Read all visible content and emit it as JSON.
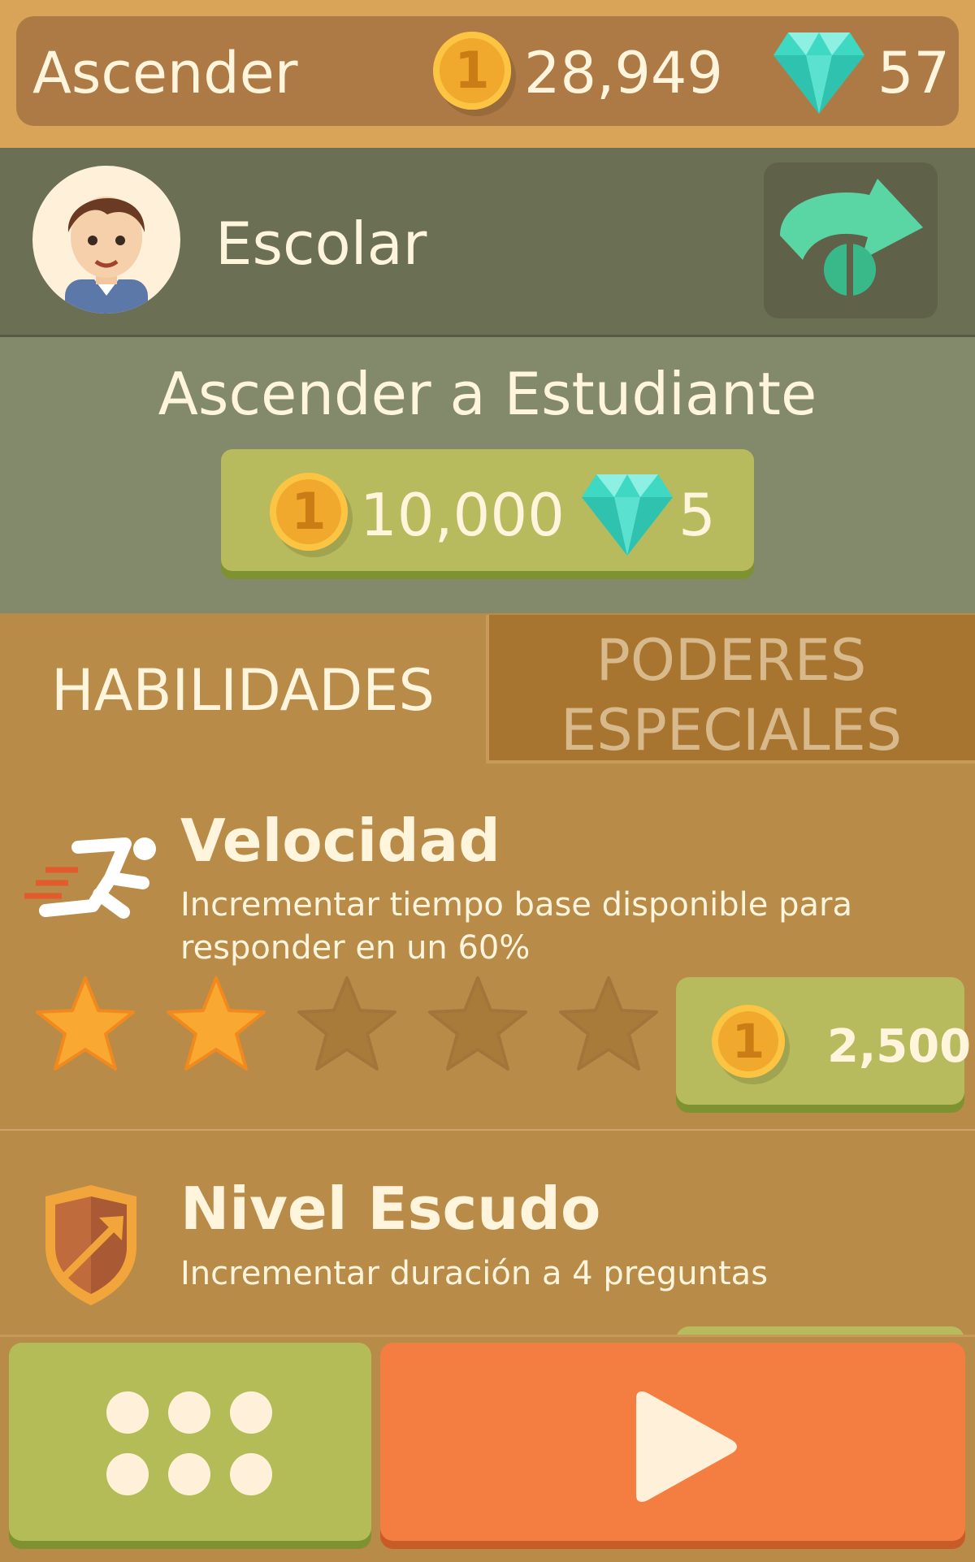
{
  "header": {
    "title": "Ascender",
    "coins": "28,949",
    "gems": "57",
    "coin_glyph": "1"
  },
  "profile": {
    "rank": "Escolar",
    "avatar_icon": "boy-avatar-icon",
    "action_icon": "rank-arrow-icon"
  },
  "ascend": {
    "title": "Ascender a Estudiante",
    "coin_cost": "10,000",
    "gem_cost": "5"
  },
  "tabs": [
    {
      "label": "HABILIDADES",
      "active": true
    },
    {
      "label": "PODERES ESPECIALES",
      "active": false
    }
  ],
  "skills": [
    {
      "title": "Velocidad",
      "description": "Incrementar tiempo base disponible para responder en un 60%",
      "stars_filled": 2,
      "stars_total": 5,
      "price": "2,500",
      "icon": "runner-icon"
    },
    {
      "title": "Nivel Escudo",
      "description": "Incrementar duración a 4 preguntas",
      "icon": "shield-icon"
    }
  ],
  "colors": {
    "accent_green": "#b7bb5d",
    "play_orange": "#f47d42",
    "coin_gold": "#f0a92c",
    "gem_teal": "#3fd8c3",
    "text_cream": "#fff4dc"
  },
  "bottom": {
    "menu_icon": "grid-dots-icon",
    "play_icon": "play-icon"
  }
}
